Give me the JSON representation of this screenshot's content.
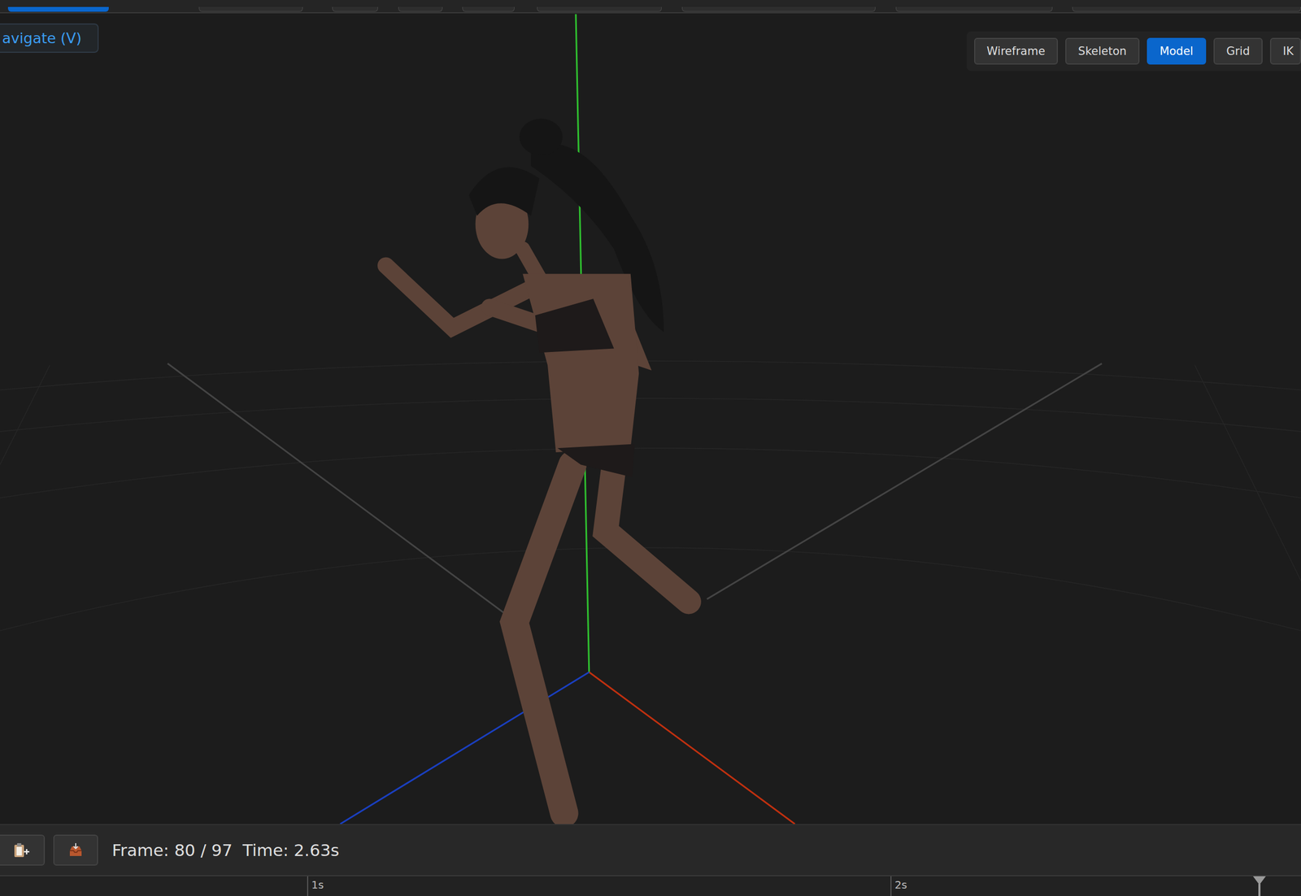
{
  "navigate_button": {
    "label": "avigate (V)"
  },
  "view_toggles": [
    {
      "label": "Wireframe",
      "selected": false
    },
    {
      "label": "Skeleton",
      "selected": false
    },
    {
      "label": "Model",
      "selected": true
    },
    {
      "label": "Grid",
      "selected": false
    },
    {
      "label": "IK",
      "selected": false
    }
  ],
  "frame_info": {
    "frame": "Frame: 80 / 97",
    "time": "Time: 2.63s"
  },
  "timeline": {
    "ticks": [
      "1s",
      "2s"
    ],
    "level": 0.968
  }
}
